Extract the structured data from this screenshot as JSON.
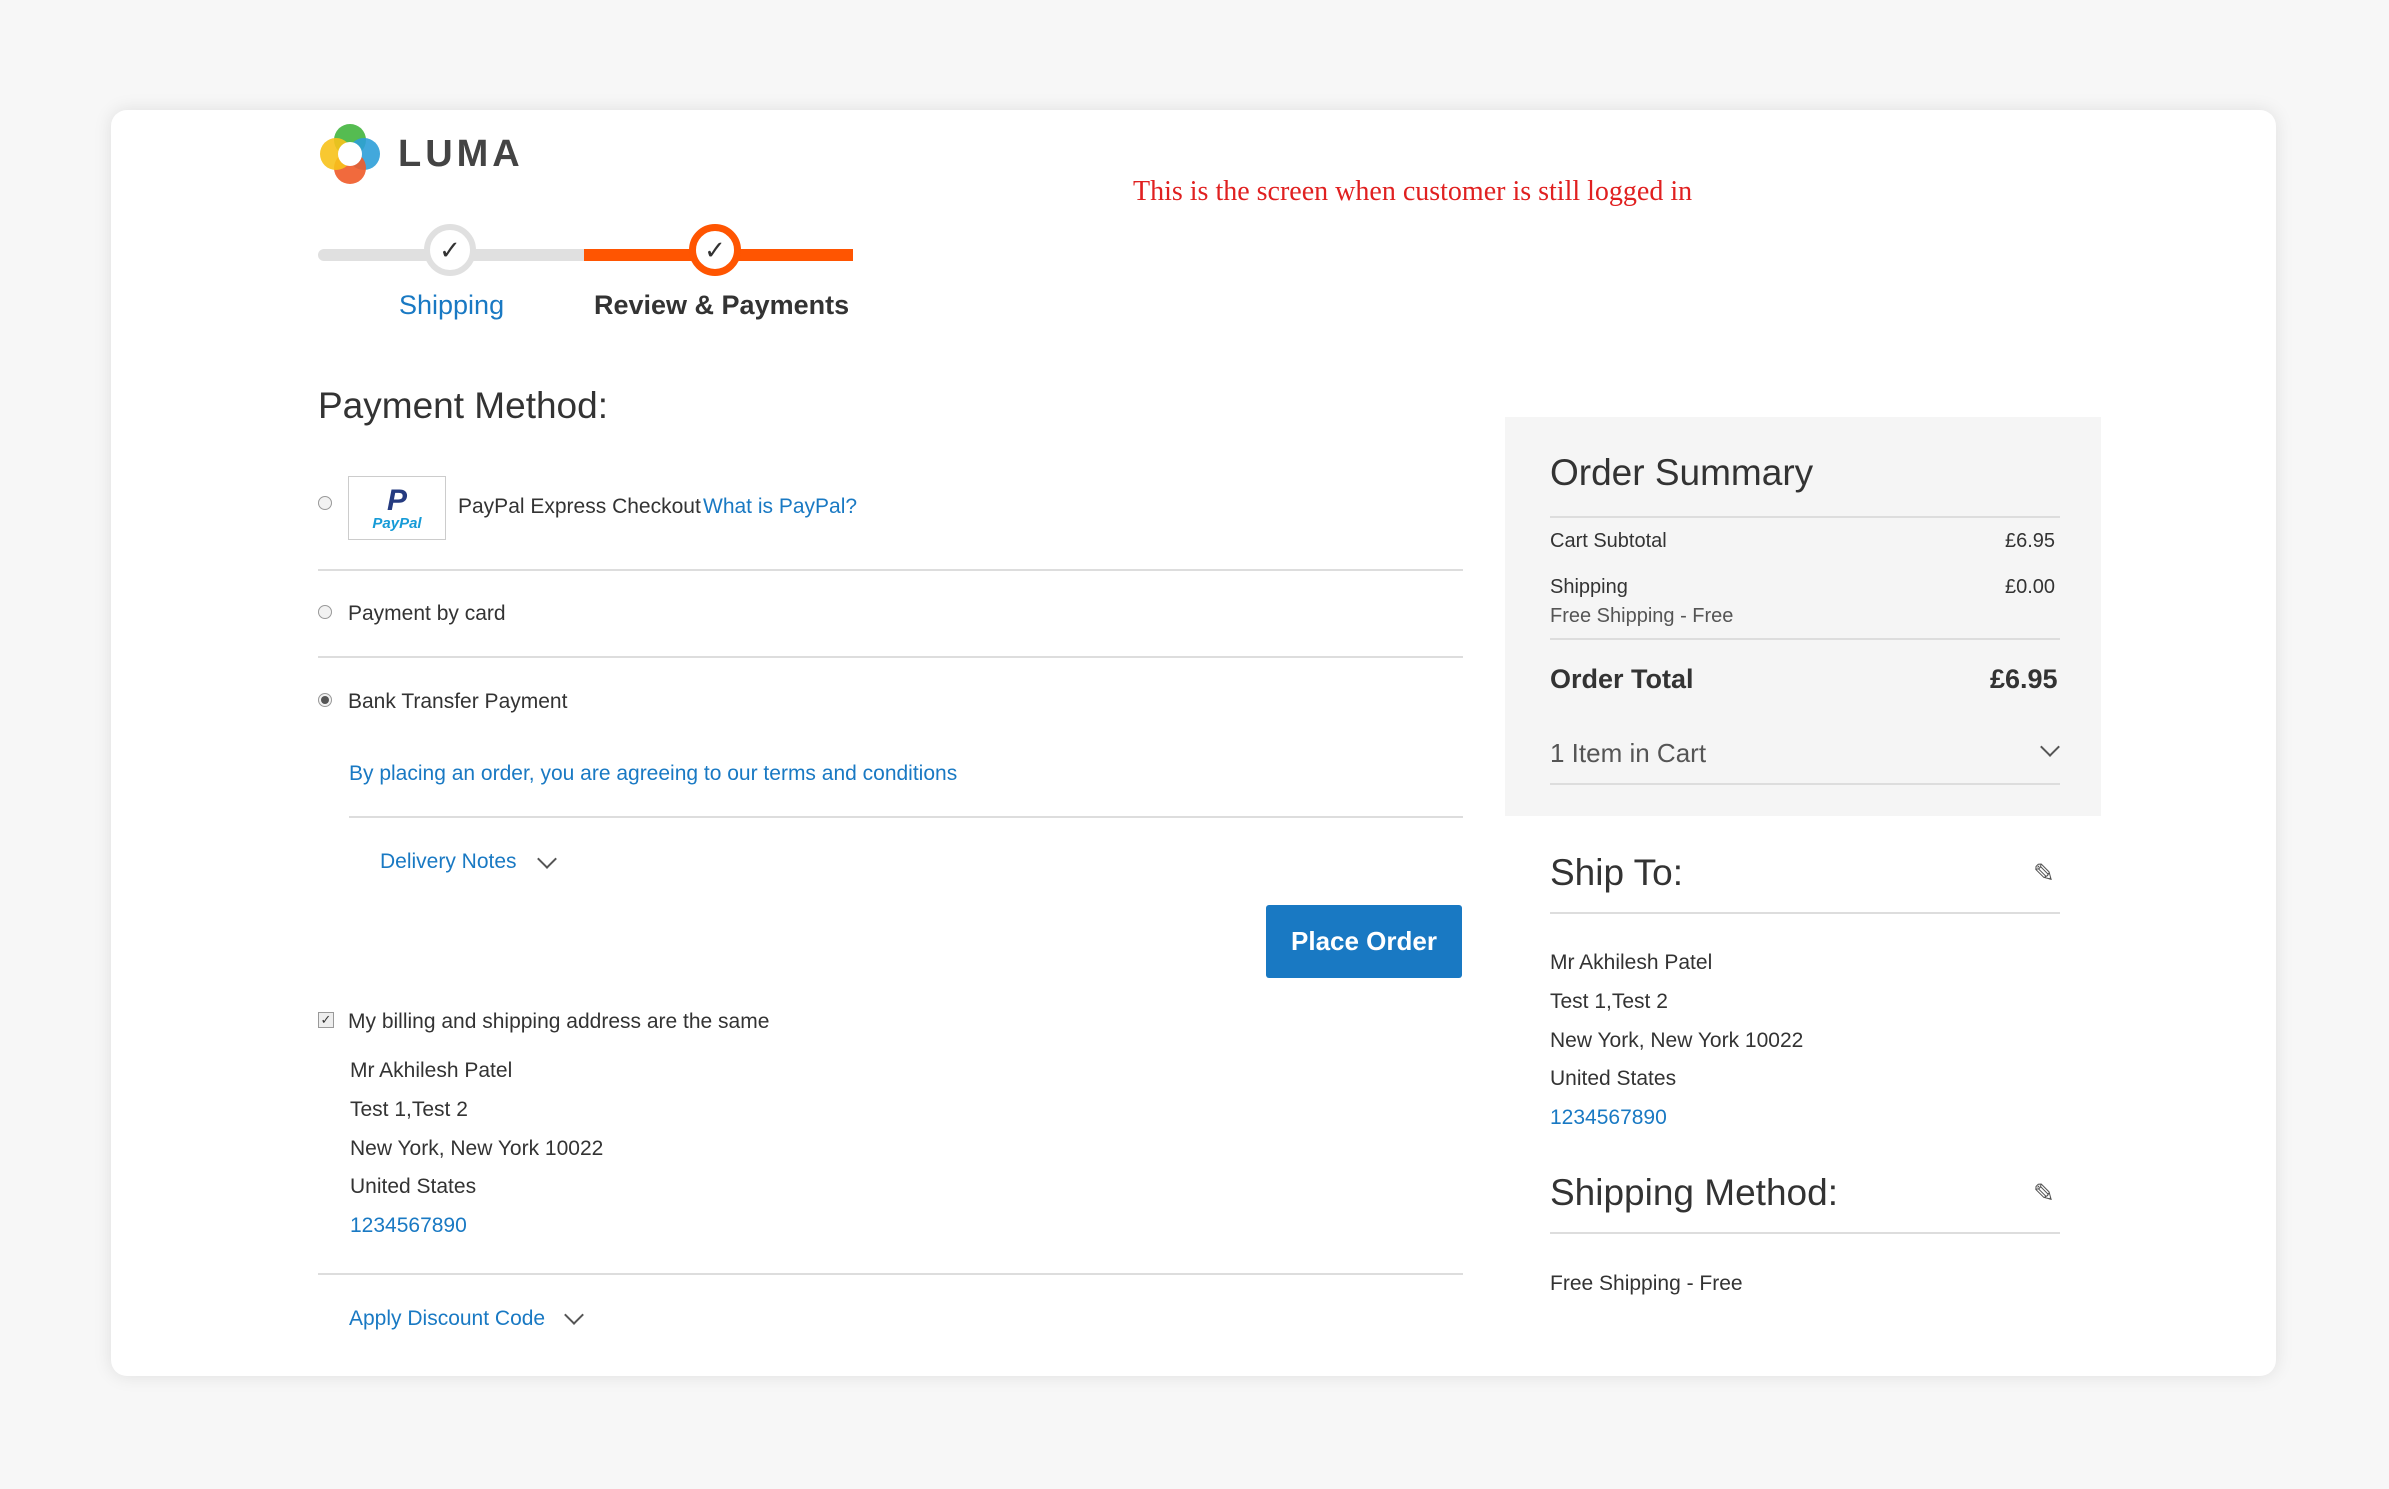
{
  "annotation": "This is the screen when customer is still logged in",
  "brand": {
    "name": "LUMA"
  },
  "progress": {
    "steps": [
      {
        "label": "Shipping",
        "state": "complete"
      },
      {
        "label": "Review & Payments",
        "state": "active"
      }
    ]
  },
  "payment": {
    "title": "Payment Method:",
    "methods": [
      {
        "label": "PayPal Express Checkout",
        "link": "What is PayPal?",
        "selected": false
      },
      {
        "label": "Payment by card",
        "selected": false
      },
      {
        "label": "Bank Transfer Payment",
        "selected": true
      }
    ],
    "paypal_logo_text": "PayPal",
    "terms_text": "By placing an order, you are agreeing to our terms and conditions",
    "delivery_notes_label": "Delivery Notes",
    "place_order_label": "Place Order",
    "same_address_label": "My billing and shipping address are the same",
    "same_address_checked": true,
    "billing_address": {
      "name": "Mr Akhilesh Patel",
      "street": "Test 1,Test 2",
      "city": "New York, New York 10022",
      "country": "United States",
      "phone": "1234567890"
    },
    "discount_label": "Apply Discount Code"
  },
  "summary": {
    "title": "Order Summary",
    "cart_subtotal_label": "Cart Subtotal",
    "cart_subtotal_value": "£6.95",
    "shipping_label": "Shipping",
    "shipping_value": "£0.00",
    "shipping_method_text": "Free Shipping - Free",
    "order_total_label": "Order Total",
    "order_total_value": "£6.95",
    "items_in_cart": "1 Item in Cart"
  },
  "ship_to": {
    "title": "Ship To:",
    "name": "Mr Akhilesh Patel",
    "street": "Test 1,Test 2",
    "city": "New York, New York 10022",
    "country": "United States",
    "phone": "1234567890"
  },
  "shipping_method": {
    "title": "Shipping Method:",
    "value": "Free Shipping - Free"
  },
  "colors": {
    "accent": "#1979c3",
    "progress": "#ff5501",
    "annotation": "#e02020"
  },
  "icons": [
    "luma-logo-icon",
    "check-icon",
    "chevron-down-icon",
    "pencil-icon"
  ]
}
